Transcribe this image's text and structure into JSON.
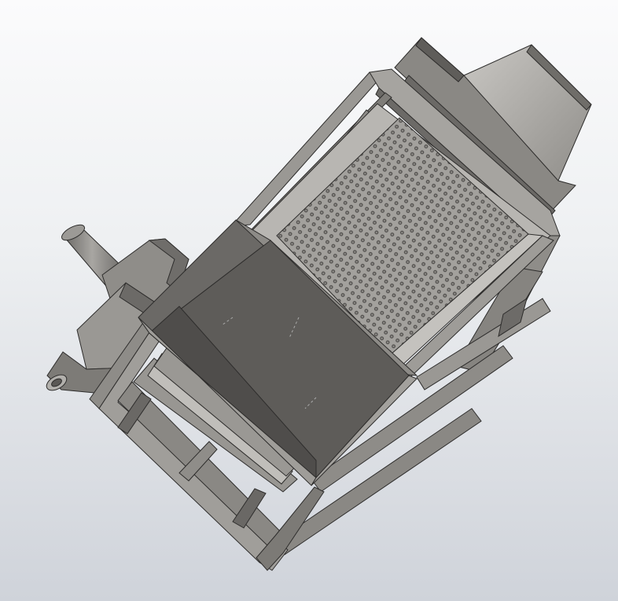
{
  "viewport": {
    "background_top": "#fbfbfc",
    "background_bottom": "#cfd3da"
  },
  "model": {
    "colors": {
      "frame": "#8e8c88",
      "frame_dark": "#5f5d5a",
      "frame_light": "#b4b2ae",
      "panel_dark": "#5b5956",
      "panel_mid": "#7d7b77",
      "panel_light": "#a9a7a3",
      "mesh": "#9d9b97",
      "mesh_hole": "#4c4a48",
      "edge": "#2e2d2c"
    }
  }
}
